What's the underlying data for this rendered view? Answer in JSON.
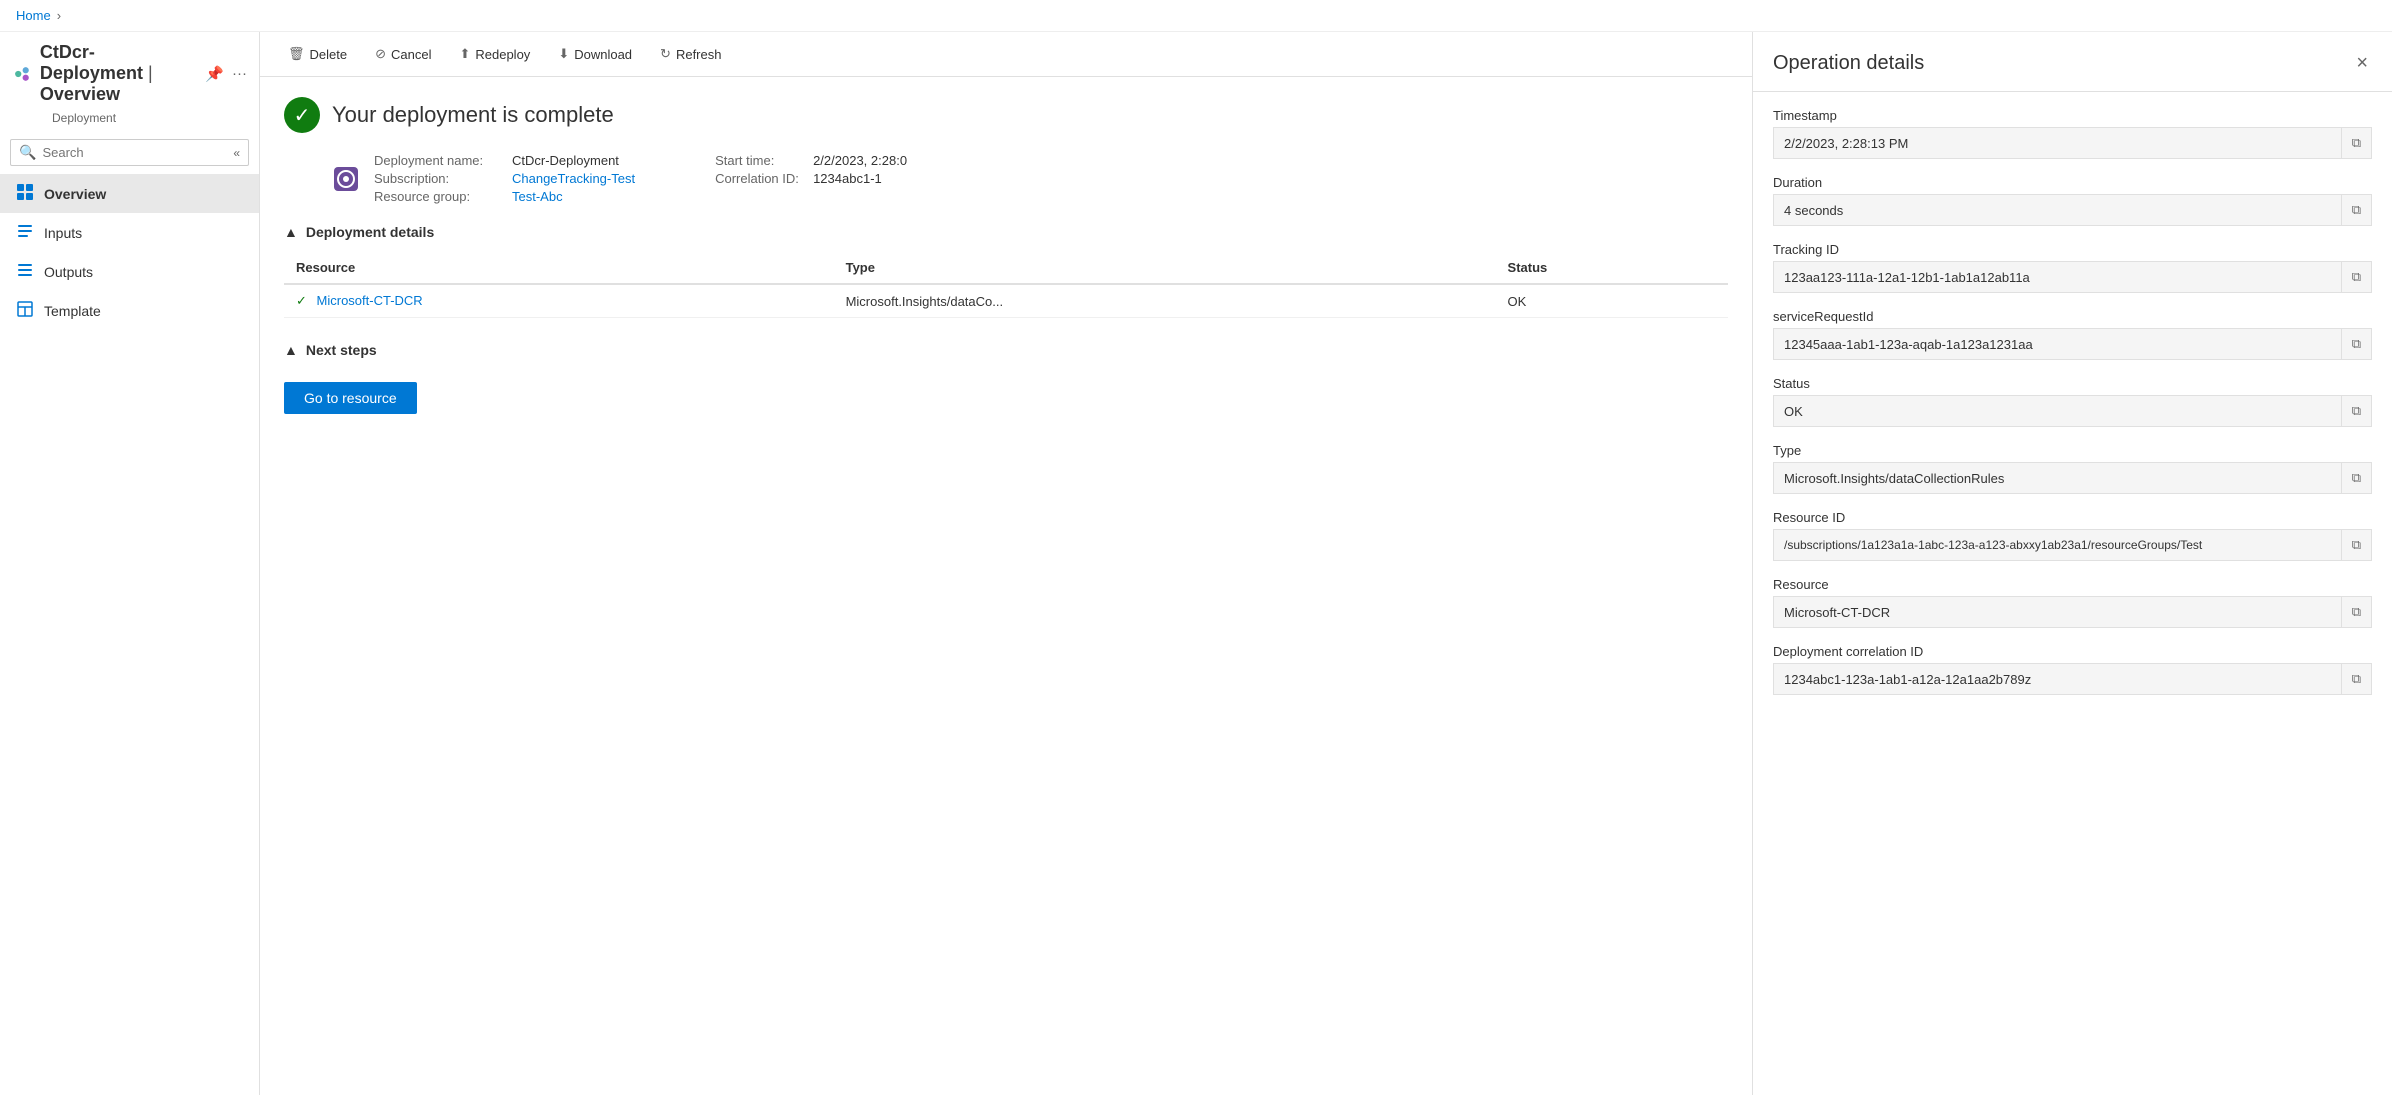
{
  "breadcrumb": {
    "home": "Home"
  },
  "sidebar": {
    "title": "CtDcr-Deployment",
    "pipe": "|",
    "page": "Overview",
    "subtitle": "Deployment",
    "search_placeholder": "Search",
    "nav_items": [
      {
        "id": "overview",
        "label": "Overview",
        "icon": "overview",
        "active": true
      },
      {
        "id": "inputs",
        "label": "Inputs",
        "icon": "inputs",
        "active": false
      },
      {
        "id": "outputs",
        "label": "Outputs",
        "icon": "outputs",
        "active": false
      },
      {
        "id": "template",
        "label": "Template",
        "icon": "template",
        "active": false
      }
    ]
  },
  "toolbar": {
    "delete_label": "Delete",
    "cancel_label": "Cancel",
    "redeploy_label": "Redeploy",
    "download_label": "Download",
    "refresh_label": "Refresh"
  },
  "deployment": {
    "status_message": "Your deployment is complete",
    "name_label": "Deployment name:",
    "name_value": "CtDcr-Deployment",
    "subscription_label": "Subscription:",
    "subscription_value": "ChangeTracking-Test",
    "resource_group_label": "Resource group:",
    "resource_group_value": "Test-Abc",
    "start_time_label": "Start time:",
    "start_time_value": "2/2/2023, 2:28:0",
    "correlation_label": "Correlation ID:",
    "correlation_value": "1234abc1-1",
    "details_section": "Deployment details",
    "table": {
      "columns": [
        "Resource",
        "Type",
        "Status"
      ],
      "rows": [
        {
          "resource": "Microsoft-CT-DCR",
          "type": "Microsoft.Insights/dataCo...",
          "status": "OK"
        }
      ]
    },
    "next_steps_section": "Next steps",
    "go_to_resource_label": "Go to resource"
  },
  "operation_details": {
    "title": "Operation details",
    "close_label": "×",
    "fields": [
      {
        "label": "Timestamp",
        "value": "2/2/2023, 2:28:13 PM",
        "id": "timestamp"
      },
      {
        "label": "Duration",
        "value": "4 seconds",
        "id": "duration"
      },
      {
        "label": "Tracking ID",
        "value": "123aa123-111a-12a1-12b1-1ab1a12ab11a",
        "id": "tracking-id"
      },
      {
        "label": "serviceRequestId",
        "value": "12345aaa-1ab1-123a-aqab-1a123a1231aa",
        "id": "service-request-id"
      },
      {
        "label": "Status",
        "value": "OK",
        "id": "status"
      },
      {
        "label": "Type",
        "value": "Microsoft.Insights/dataCollectionRules",
        "id": "type"
      },
      {
        "label": "Resource ID",
        "value": "/subscriptions/1a123a1a-1abc-123a-a123-abxxy1ab23a1/resourceGroups/Test",
        "id": "resource-id"
      },
      {
        "label": "Resource",
        "value": "Microsoft-CT-DCR",
        "id": "resource"
      },
      {
        "label": "Deployment correlation ID",
        "value": "1234abc1-123a-1ab1-a12a-12a1aa2b789z",
        "id": "deployment-correlation-id"
      }
    ]
  }
}
